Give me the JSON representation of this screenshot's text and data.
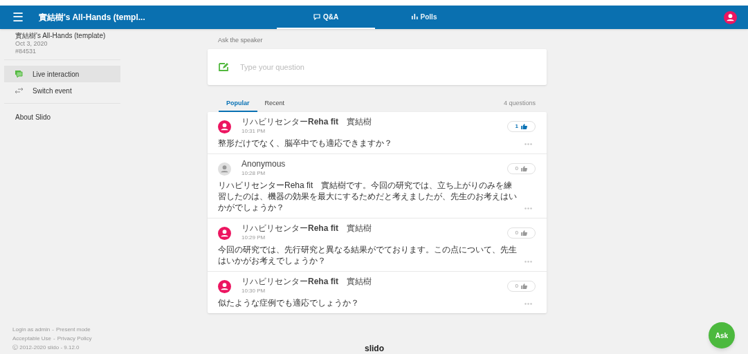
{
  "header": {
    "menu_icon": "☰",
    "title": "實結樹's All-Hands (templ..."
  },
  "nav_tabs": [
    {
      "label": "Q&A",
      "kind": "qa",
      "selected": true
    },
    {
      "label": "Polls",
      "kind": "polls",
      "selected": false
    }
  ],
  "sidebar": {
    "event_name": "實結樹's All-Hands (template)",
    "date": "Oct 3, 2020",
    "code": "#84531",
    "items": [
      {
        "label": "Live interaction",
        "kind": "live",
        "selected": true
      },
      {
        "label": "Switch event",
        "kind": "switch",
        "selected": false
      }
    ],
    "about": "About Slido",
    "footer": [
      [
        "Login as admin",
        "Present mode"
      ],
      [
        "Acceptable Use",
        "Privacy Policy"
      ]
    ],
    "footer_separator": "-",
    "copyright": "Ⓒ 2012-2020 slido - 9.12.0"
  },
  "ask_label": "Ask the speaker",
  "question_input": {
    "placeholder": "Type your question"
  },
  "list_tabs": [
    {
      "label": "Popular",
      "selected": true
    },
    {
      "label": "Recent",
      "selected": false
    }
  ],
  "question_count": "4 questions",
  "questions": [
    {
      "author": "リハビリセンター**Reha fit**　實結樹",
      "kind": "named",
      "time": "10:31 PM",
      "text": "整形だけでなく、脳卒中でも適応できますか？",
      "likes": "1",
      "voted": true
    },
    {
      "author": "Anonymous",
      "kind": "anonymous",
      "time": "10:28 PM",
      "text": "リハビリセンターReha fit　實結樹です。今回の研究では、立ち上がりのみを練習したのは、機器の効果を最大にするためだと考えましたが、先生のお考えはいかがでしょうか？",
      "likes": "0",
      "voted": false
    },
    {
      "author": "リハビリセンター**Reha fit**　實結樹",
      "kind": "named",
      "time": "10:29 PM",
      "text": "今回の研究では、先行研究と異なる結果がでております。この点について、先生はいかがお考えでしょうか？",
      "likes": "0",
      "voted": false
    },
    {
      "author": "リハビリセンター**Reha fit**　實結樹",
      "kind": "named",
      "time": "10:30 PM",
      "text": "似たような症例でも適応でしょうか？",
      "likes": "0",
      "voted": false
    }
  ],
  "brand": "slido",
  "ask_button": "Ask"
}
